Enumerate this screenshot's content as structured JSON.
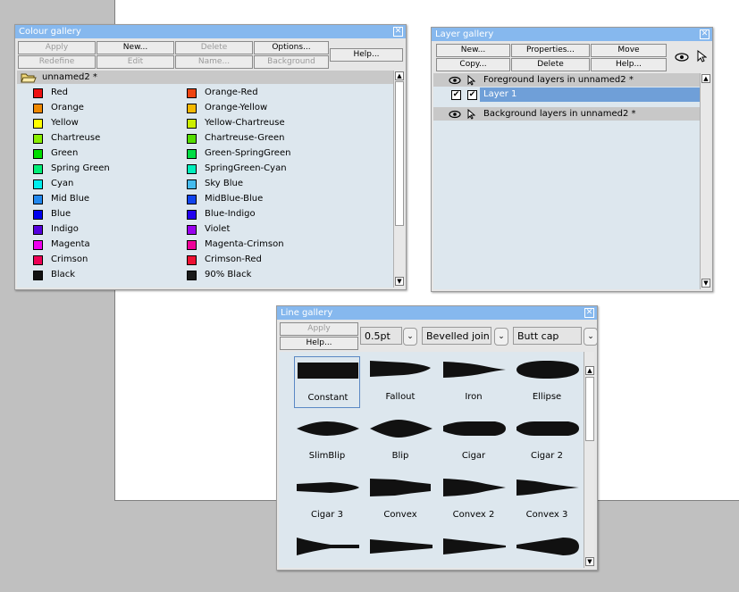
{
  "colour_gallery": {
    "title": "Colour gallery",
    "buttons_row1": [
      "Apply",
      "New...",
      "Delete",
      "Options..."
    ],
    "buttons_row2": [
      "Redefine",
      "Edit",
      "Name...",
      "Background"
    ],
    "help": "Help...",
    "folder": "unnamed2 *",
    "left_column": [
      {
        "name": "Red",
        "color": "#ee1111"
      },
      {
        "name": "Orange",
        "color": "#ee8800"
      },
      {
        "name": "Yellow",
        "color": "#ffff00"
      },
      {
        "name": "Chartreuse",
        "color": "#88ee00"
      },
      {
        "name": "Green",
        "color": "#00dd00"
      },
      {
        "name": "Spring Green",
        "color": "#00ee77"
      },
      {
        "name": "Cyan",
        "color": "#00eeee"
      },
      {
        "name": "Mid Blue",
        "color": "#2288ee"
      },
      {
        "name": "Blue",
        "color": "#0000ee"
      },
      {
        "name": "Indigo",
        "color": "#5500dd"
      },
      {
        "name": "Magenta",
        "color": "#ee00ee"
      },
      {
        "name": "Crimson",
        "color": "#ee0055"
      },
      {
        "name": "Black",
        "color": "#111111"
      }
    ],
    "right_column": [
      {
        "name": "Orange-Red",
        "color": "#ee4411"
      },
      {
        "name": "Orange-Yellow",
        "color": "#f5b800"
      },
      {
        "name": "Yellow-Chartreuse",
        "color": "#ccee00"
      },
      {
        "name": "Chartreuse-Green",
        "color": "#55dd00"
      },
      {
        "name": "Green-SpringGreen",
        "color": "#00dd44"
      },
      {
        "name": "SpringGreen-Cyan",
        "color": "#00eebb"
      },
      {
        "name": "Sky Blue",
        "color": "#44bbee"
      },
      {
        "name": "MidBlue-Blue",
        "color": "#1144ee"
      },
      {
        "name": "Blue-Indigo",
        "color": "#2200ee"
      },
      {
        "name": "Violet",
        "color": "#9900ee"
      },
      {
        "name": "Magenta-Crimson",
        "color": "#ee0099"
      },
      {
        "name": "Crimson-Red",
        "color": "#ee1133"
      },
      {
        "name": "90% Black",
        "color": "#1a1a1a"
      }
    ]
  },
  "layer_gallery": {
    "title": "Layer gallery",
    "buttons_row1": [
      "New...",
      "Properties...",
      "Move"
    ],
    "buttons_row2": [
      "Copy...",
      "Delete",
      "Help..."
    ],
    "foreground_header": "Foreground layers in unnamed2 *",
    "layer_name": "Layer 1",
    "background_header": "Background layers in unnamed2 *",
    "selected_color": "#6f9fd8"
  },
  "line_gallery": {
    "title": "Line gallery",
    "apply": "Apply",
    "help": "Help...",
    "width": "0.5pt",
    "join": "Bevelled join",
    "cap": "Butt cap",
    "styles": [
      {
        "name": "Constant",
        "shape": "constant"
      },
      {
        "name": "Fallout",
        "shape": "fallout"
      },
      {
        "name": "Iron",
        "shape": "iron"
      },
      {
        "name": "Ellipse",
        "shape": "ellipse"
      },
      {
        "name": "SlimBlip",
        "shape": "slimblip"
      },
      {
        "name": "Blip",
        "shape": "blip"
      },
      {
        "name": "Cigar",
        "shape": "cigar"
      },
      {
        "name": "Cigar 2",
        "shape": "cigar2"
      },
      {
        "name": "Cigar 3",
        "shape": "cigar3"
      },
      {
        "name": "Convex",
        "shape": "convex"
      },
      {
        "name": "Convex 2",
        "shape": "convex2"
      },
      {
        "name": "Convex 3",
        "shape": "convex3"
      },
      {
        "name": "",
        "shape": "wedge"
      },
      {
        "name": "",
        "shape": "wedge2"
      },
      {
        "name": "",
        "shape": "wedge3"
      },
      {
        "name": "",
        "shape": "teardrop"
      }
    ]
  }
}
